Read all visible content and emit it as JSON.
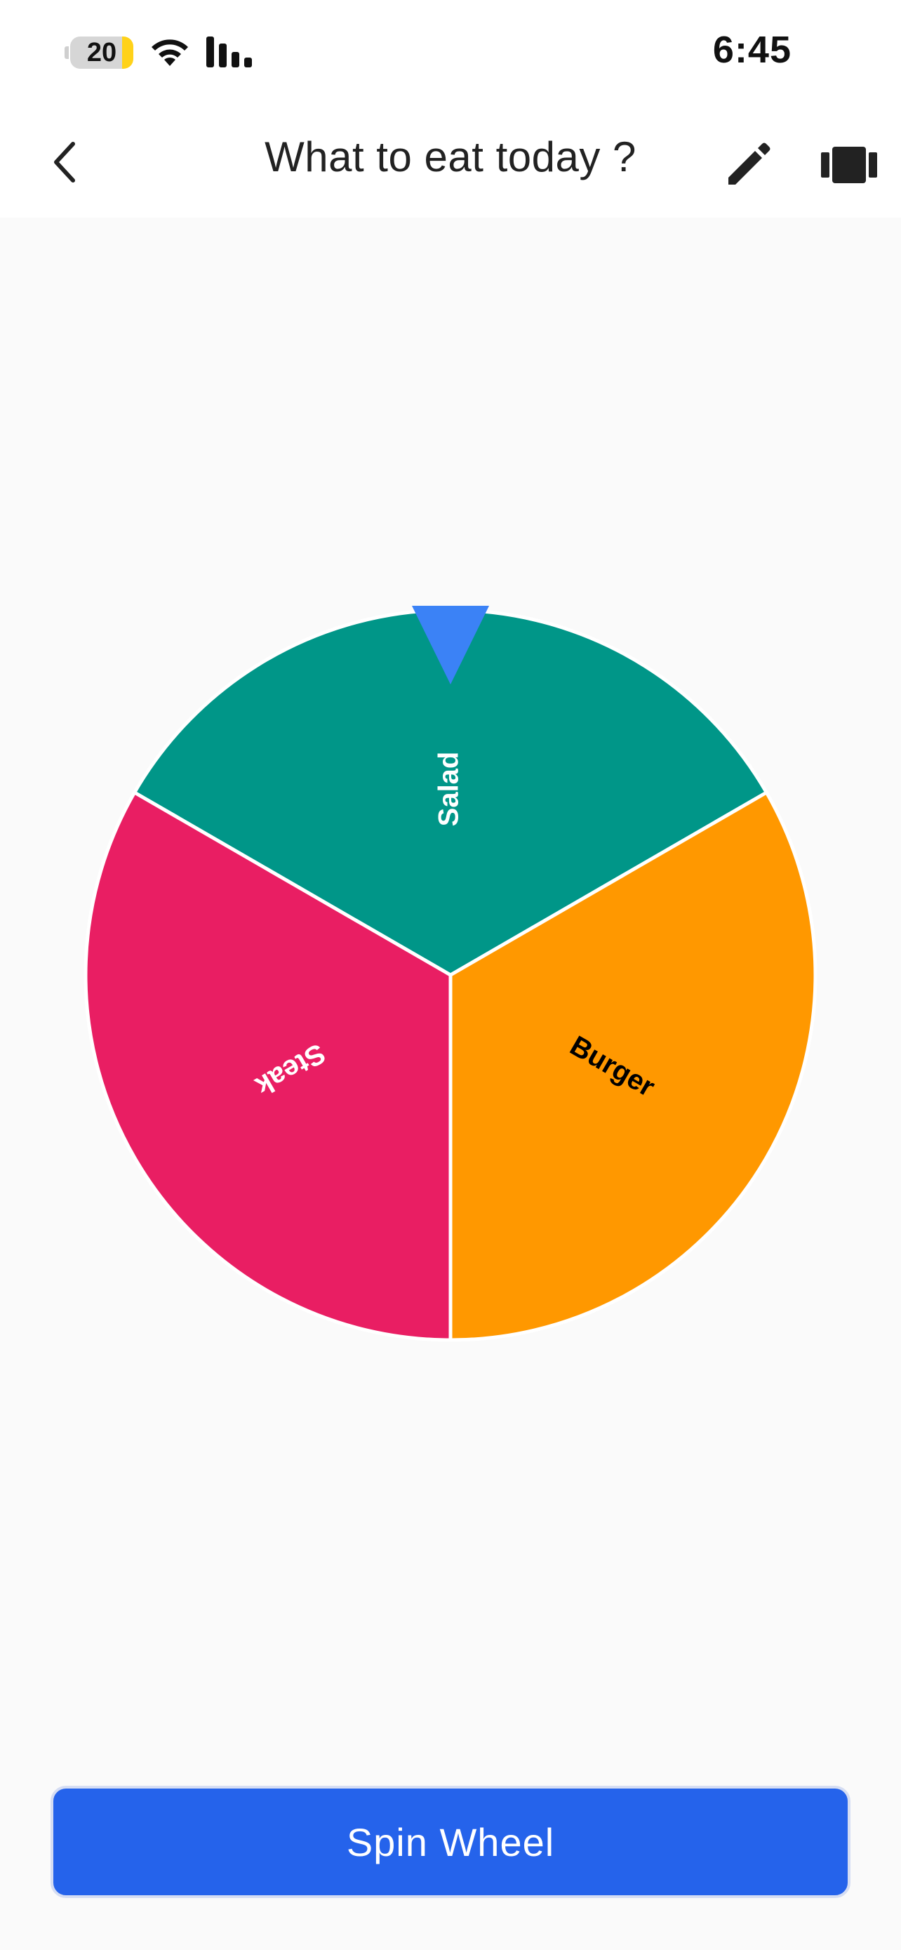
{
  "status_bar": {
    "battery": "20",
    "time": "6:45",
    "icons": [
      "battery-icon",
      "wifi-icon",
      "signal-icon"
    ]
  },
  "header": {
    "title": "What to eat today ?",
    "icons": [
      "back-chevron-icon",
      "pencil-icon",
      "carousel-icon"
    ]
  },
  "wheel": {
    "segments": [
      {
        "label": "Salad",
        "color": "#009688",
        "text_color": "#ffffff"
      },
      {
        "label": "Burger",
        "color": "#ff9800",
        "text_color": "#000000"
      },
      {
        "label": "Steak",
        "color": "#e91e63",
        "text_color": "#ffffff"
      }
    ],
    "pointer_color": "#3b82f6"
  },
  "actions": {
    "spin_label": "Spin Wheel",
    "spin_color": "#2563eb"
  }
}
